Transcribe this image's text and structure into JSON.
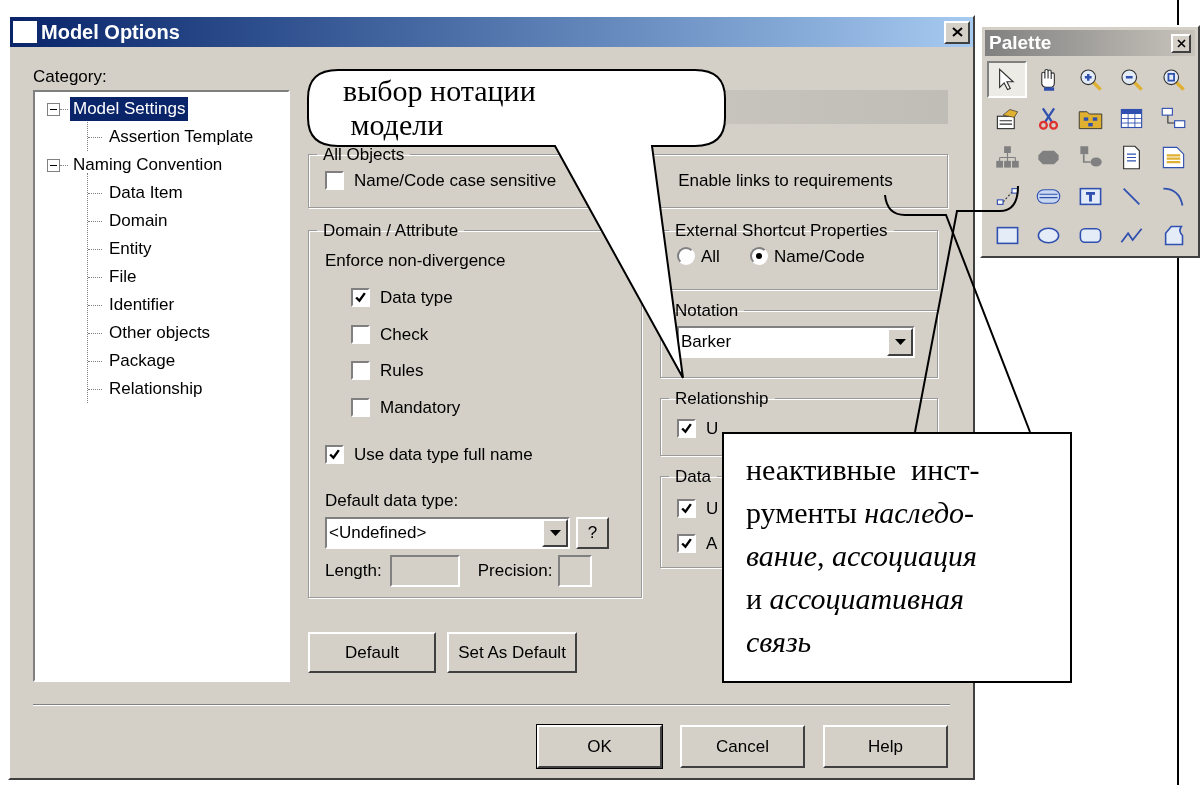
{
  "dialog": {
    "title": "Model Options",
    "category_label": "Category:",
    "tree": [
      {
        "label": "Model Settings",
        "selected": true,
        "expanded": true,
        "children": [
          {
            "label": "Assertion Template",
            "selected": false
          }
        ]
      },
      {
        "label": "Naming Convention",
        "selected": false,
        "expanded": true,
        "children": [
          {
            "label": "Data Item",
            "selected": false
          },
          {
            "label": "Domain",
            "selected": false
          },
          {
            "label": "Entity",
            "selected": false
          },
          {
            "label": "File",
            "selected": false
          },
          {
            "label": "Identifier",
            "selected": false
          },
          {
            "label": "Other objects",
            "selected": false
          },
          {
            "label": "Package",
            "selected": false
          },
          {
            "label": "Relationship",
            "selected": false
          }
        ]
      }
    ],
    "all_objects": {
      "title": "All Objects",
      "case_sensitive": {
        "label": "Name/Code case sensitive",
        "checked": false
      },
      "enable_links_label": "Enable links to requirements"
    },
    "domain_attribute": {
      "title": "Domain / Attribute",
      "enforce_label": "Enforce non-divergence",
      "options": [
        {
          "label": "Data type",
          "checked": true
        },
        {
          "label": "Check",
          "checked": false
        },
        {
          "label": "Rules",
          "checked": false
        },
        {
          "label": "Mandatory",
          "checked": false
        }
      ],
      "full_name": {
        "label": "Use data type full name",
        "checked": true
      },
      "default_type_label": "Default data type:",
      "default_type_value": "<Undefined>",
      "help_button": "?",
      "length_label": "Length:",
      "precision_label": "Precision:"
    },
    "shortcut": {
      "title": "External Shortcut Properties",
      "options": [
        {
          "label": "All",
          "selected": false
        },
        {
          "label": "Name/Code",
          "selected": true
        }
      ]
    },
    "notation": {
      "title": "Notation",
      "value": "Barker"
    },
    "relationship": {
      "title": "Relationship",
      "options": [
        {
          "label": "U",
          "checked": true
        }
      ]
    },
    "data_group": {
      "title": "Data",
      "options": [
        {
          "label": "U",
          "checked": true
        },
        {
          "label": "A",
          "checked": true
        }
      ]
    },
    "left_buttons": [
      "Default",
      "Set As Default"
    ],
    "buttons": [
      "OK",
      "Cancel",
      "Help"
    ]
  },
  "palette": {
    "title": "Palette",
    "tools": [
      {
        "selected": true,
        "disabled": false
      },
      {
        "selected": false,
        "disabled": false
      },
      {
        "selected": false,
        "disabled": false
      },
      {
        "selected": false,
        "disabled": false
      },
      {
        "selected": false,
        "disabled": false
      },
      {
        "selected": false,
        "disabled": false
      },
      {
        "selected": false,
        "disabled": false
      },
      {
        "selected": false,
        "disabled": false
      },
      {
        "selected": false,
        "disabled": false
      },
      {
        "selected": false,
        "disabled": false
      },
      {
        "selected": false,
        "disabled": true
      },
      {
        "selected": false,
        "disabled": true
      },
      {
        "selected": false,
        "disabled": true
      },
      {
        "selected": false,
        "disabled": false
      },
      {
        "selected": false,
        "disabled": false
      },
      {
        "selected": false,
        "disabled": false
      },
      {
        "selected": false,
        "disabled": false
      },
      {
        "selected": false,
        "disabled": false
      },
      {
        "selected": false,
        "disabled": false
      },
      {
        "selected": false,
        "disabled": false
      },
      {
        "selected": false,
        "disabled": false
      },
      {
        "selected": false,
        "disabled": false
      },
      {
        "selected": false,
        "disabled": false
      },
      {
        "selected": false,
        "disabled": false
      },
      {
        "selected": false,
        "disabled": false
      }
    ]
  },
  "callouts": [
    {
      "text": "выбор нотации\n модели"
    },
    {
      "text": "неактивные  инст-\nрументы *наследо-*\n*вание*, *ассоциация*\nи *ассоциативная*\n*связь*"
    }
  ]
}
